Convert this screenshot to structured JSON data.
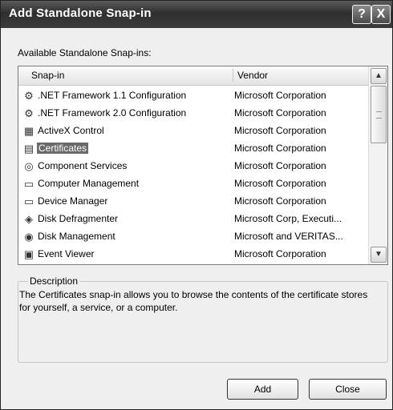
{
  "window": {
    "title": "Add Standalone Snap-in",
    "help_glyph": "?",
    "close_glyph": "X"
  },
  "list_label": "Available Standalone Snap-ins:",
  "columns": {
    "snapin": "Snap-in",
    "vendor": "Vendor"
  },
  "rows": [
    {
      "name": ".NET Framework 1.1 Configuration",
      "vendor": "Microsoft Corporation",
      "icon": "net-config-icon",
      "glyph": "⚙"
    },
    {
      "name": ".NET Framework 2.0 Configuration",
      "vendor": "Microsoft Corporation",
      "icon": "net-config-icon",
      "glyph": "⚙"
    },
    {
      "name": "ActiveX Control",
      "vendor": "Microsoft Corporation",
      "icon": "activex-icon",
      "glyph": "▦"
    },
    {
      "name": "Certificates",
      "vendor": "Microsoft Corporation",
      "icon": "certificate-icon",
      "glyph": "▤",
      "selected": true
    },
    {
      "name": "Component Services",
      "vendor": "Microsoft Corporation",
      "icon": "component-services-icon",
      "glyph": "◎"
    },
    {
      "name": "Computer Management",
      "vendor": "Microsoft Corporation",
      "icon": "computer-icon",
      "glyph": "▭"
    },
    {
      "name": "Device Manager",
      "vendor": "Microsoft Corporation",
      "icon": "device-manager-icon",
      "glyph": "▭"
    },
    {
      "name": "Disk Defragmenter",
      "vendor": "Microsoft Corp, Executi...",
      "icon": "defrag-icon",
      "glyph": "◈"
    },
    {
      "name": "Disk Management",
      "vendor": "Microsoft and VERITAS...",
      "icon": "disk-icon",
      "glyph": "◉"
    },
    {
      "name": "Event Viewer",
      "vendor": "Microsoft Corporation",
      "icon": "event-viewer-icon",
      "glyph": "▣"
    }
  ],
  "scroll": {
    "up": "▲",
    "down": "▼"
  },
  "description": {
    "label": "Description",
    "text": "The Certificates snap-in allows you to browse the contents of the certificate stores for yourself, a service, or a computer."
  },
  "buttons": {
    "add": "Add",
    "close": "Close"
  }
}
